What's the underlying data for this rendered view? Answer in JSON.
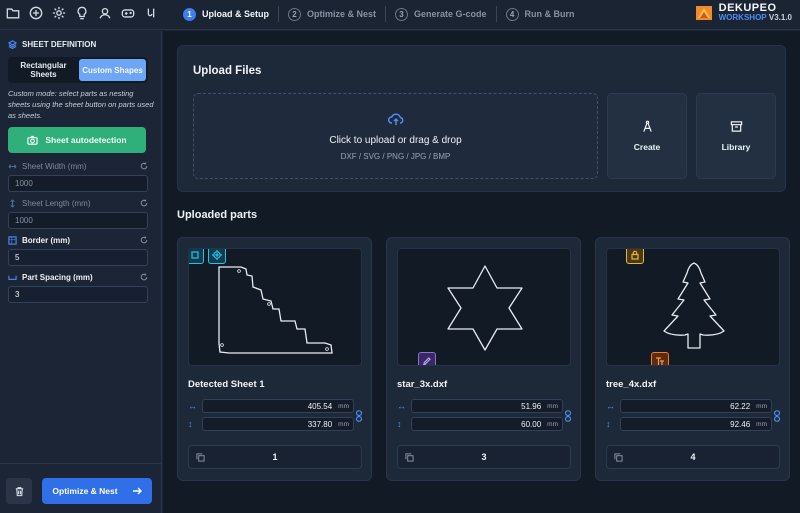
{
  "toolbar": {
    "icons": [
      "folder-icon",
      "add-circle-icon",
      "settings-gear-icon",
      "lightbulb-icon",
      "user-icon",
      "gamepad-icon",
      "code-icon"
    ]
  },
  "steps": [
    {
      "number": "1",
      "label": "Upload & Setup",
      "active": true
    },
    {
      "number": "2",
      "label": "Optimize & Nest",
      "active": false
    },
    {
      "number": "3",
      "label": "Generate G-code",
      "active": false
    },
    {
      "number": "4",
      "label": "Run & Burn",
      "active": false
    }
  ],
  "brand": {
    "name": "DEKUPEO",
    "sub": "WORKSHOP",
    "version": "V3.1.0"
  },
  "sidebar": {
    "title": "SHEET DEFINITION",
    "mode_rectangular": "Rectangular Sheets",
    "mode_custom": "Custom Shapes",
    "note": "Custom mode: select parts as nesting sheets using the sheet button on parts used as sheets.",
    "autodetect_label": "Sheet autodetection",
    "sheet_width_label": "Sheet Width  (mm)",
    "sheet_width_value": "1000",
    "sheet_length_label": "Sheet Length  (mm)",
    "sheet_length_value": "1000",
    "border_label": "Border  (mm)",
    "border_value": "5",
    "spacing_label": "Part Spacing  (mm)",
    "spacing_value": "3",
    "optimize_label": "Optimize & Nest"
  },
  "upload": {
    "title": "Upload Files",
    "drop_main": "Click to upload or drag & drop",
    "drop_formats": "DXF / SVG / PNG / JPG / BMP",
    "create_label": "Create",
    "library_label": "Library"
  },
  "parts_title": "Uploaded parts",
  "parts": [
    {
      "name": "Detected Sheet 1",
      "width": "405.54",
      "height": "337.80",
      "unit": "mm",
      "quantity": "1"
    },
    {
      "name": "star_3x.dxf",
      "width": "51.96",
      "height": "60.00",
      "unit": "mm",
      "quantity": "3"
    },
    {
      "name": "tree_4x.dxf",
      "width": "62.22",
      "height": "92.46",
      "unit": "mm",
      "quantity": "4"
    }
  ],
  "colors": {
    "accent": "#3d7ef2",
    "success": "#2fb07a",
    "background": "#121a26",
    "panel": "#1d2838"
  }
}
